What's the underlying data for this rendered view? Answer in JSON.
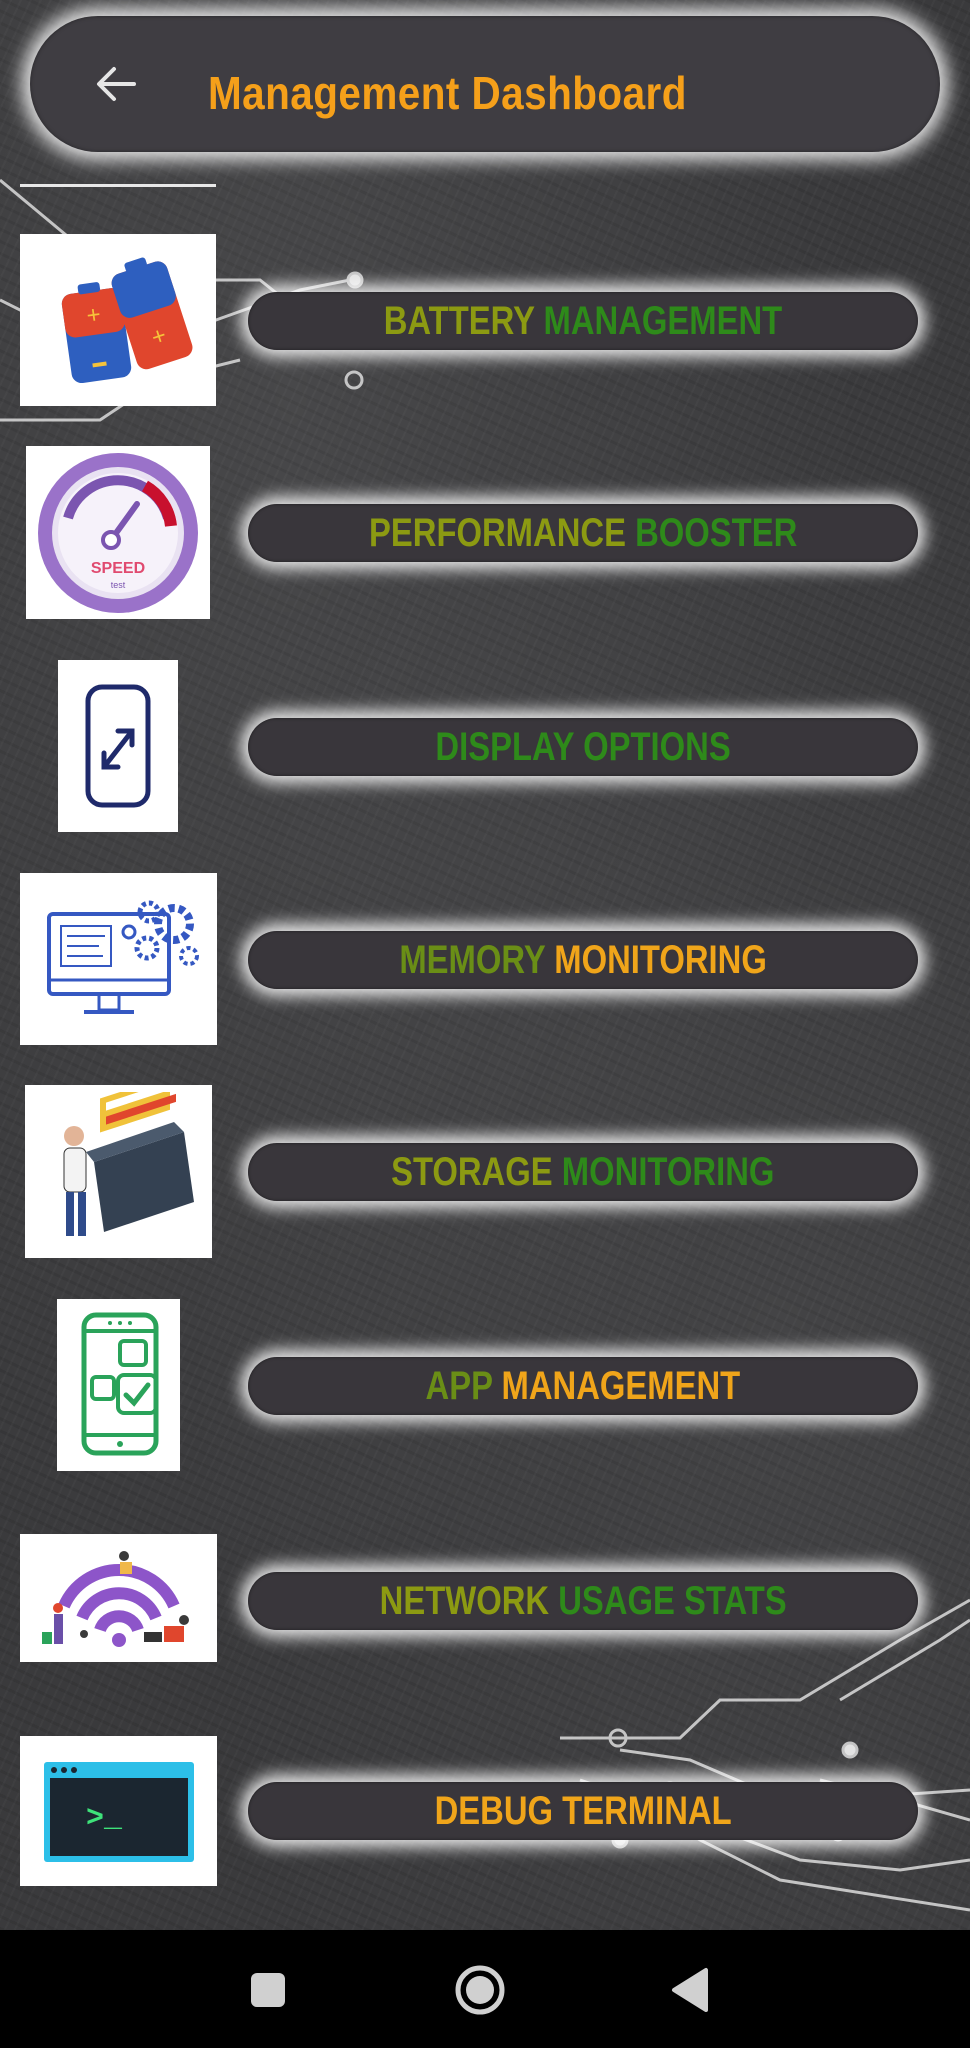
{
  "header": {
    "title": "Management Dashboard",
    "back_icon": "arrow-left-icon"
  },
  "menu": {
    "items": [
      {
        "name": "battery",
        "icon": "battery-icon",
        "words": [
          "BATTERY",
          "MANAGEMENT"
        ]
      },
      {
        "name": "performance",
        "icon": "speedometer-icon",
        "words": [
          "PERFORMANCE",
          "BOOSTER"
        ]
      },
      {
        "name": "display",
        "icon": "phone-resize-icon",
        "words": [
          "DISPLAY",
          "OPTIONS"
        ]
      },
      {
        "name": "memory",
        "icon": "computer-gears-icon",
        "words": [
          "MEMORY",
          "MONITORING"
        ]
      },
      {
        "name": "storage",
        "icon": "file-cabinet-icon",
        "words": [
          "STORAGE",
          "MONITORING"
        ]
      },
      {
        "name": "app",
        "icon": "phone-apps-icon",
        "words": [
          "APP",
          "MANAGEMENT"
        ]
      },
      {
        "name": "network",
        "icon": "wifi-people-icon",
        "words": [
          "NETWORK",
          "USAGE",
          "STATS"
        ]
      },
      {
        "name": "debug",
        "icon": "terminal-icon",
        "words": [
          "DEBUG",
          "TERMINAL"
        ]
      }
    ]
  },
  "terminal_prompt": ">_",
  "speed_label": "SPEED",
  "speed_sublabel": "test",
  "navbar": {
    "recents_icon": "square-icon",
    "home_icon": "circle-home-icon",
    "back_icon": "triangle-back-icon"
  },
  "colors": {
    "title": "#f5a01a",
    "pill_bg": "#39363b",
    "board": "#3a3a3c"
  }
}
